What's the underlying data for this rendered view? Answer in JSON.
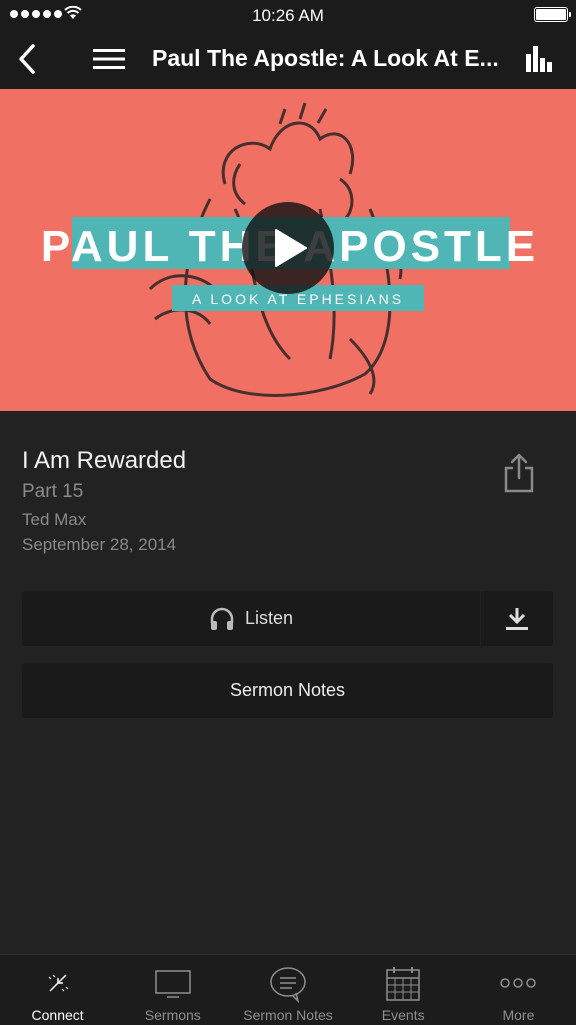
{
  "status_bar": {
    "time": "10:26 AM"
  },
  "nav": {
    "title": "Paul The Apostle: A Look At E..."
  },
  "hero": {
    "title_line": "PAUL THE APOSTLE",
    "subtitle_line": "A LOOK AT EPHESIANS"
  },
  "sermon": {
    "title": "I Am Rewarded",
    "part": "Part 15",
    "speaker": "Ted Max",
    "date": "September 28, 2014"
  },
  "actions": {
    "listen_label": "Listen",
    "notes_label": "Sermon Notes"
  },
  "tabs": [
    {
      "label": "Connect",
      "icon": "connect-icon",
      "active": true
    },
    {
      "label": "Sermons",
      "icon": "monitor-icon"
    },
    {
      "label": "Sermon Notes",
      "icon": "speech-bubble-icon"
    },
    {
      "label": "Events",
      "icon": "calendar-icon"
    },
    {
      "label": "More",
      "icon": "more-dots-icon"
    }
  ],
  "colors": {
    "hero_bg": "#f07063",
    "banner": "#4fb6b5",
    "bg": "#222222",
    "button_bg": "#1a1a1a"
  }
}
